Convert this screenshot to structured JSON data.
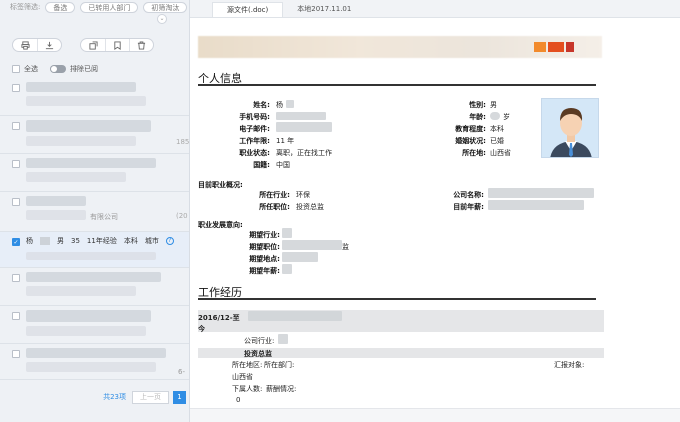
{
  "filter": {
    "label": "标签筛选:",
    "chips": [
      "备选",
      "已转用人部门",
      "初筛淘汰"
    ]
  },
  "toolbar": {
    "icons": [
      "print-icon",
      "download-icon",
      "forward-icon",
      "bookmark-icon",
      "trash-icon"
    ]
  },
  "list": {
    "select_all": "全选",
    "exclude_viewed": "排除已阅",
    "side_numbers": [
      "185",
      "(20"
    ],
    "company_fragment": "有限公司",
    "selected": {
      "name": "杨",
      "gender": "男",
      "age": "35",
      "experience": "11年经验",
      "education": "本科",
      "city": "城市"
    },
    "trailing_text": "6-"
  },
  "pagination": {
    "total": "共23项",
    "prev": "上一页",
    "page": "1"
  },
  "tabs": [
    "源文件(.doc)",
    "本地2017.11.01"
  ],
  "resume": {
    "section_personal": "个人信息",
    "name_label": "姓名:",
    "name_value": "杨",
    "gender_label": "性别:",
    "gender_value": "男",
    "phone_label": "手机号码:",
    "age_label": "年龄:",
    "age_value": "岁",
    "email_label": "电子邮件:",
    "edu_label": "教育程度:",
    "edu_value": "本科",
    "years_label": "工作年限:",
    "years_value": "11 年",
    "marital_label": "婚姻状况:",
    "marital_value": "已婚",
    "status_label": "职业状态:",
    "status_value": "离职，正在找工作",
    "location_label": "所在地:",
    "location_value": "山西省",
    "nationality_label": "国籍:",
    "nationality_value": "中国",
    "current_title": "目前职业概况:",
    "industry_label": "所在行业:",
    "industry_value": "环保",
    "company_label": "公司名称:",
    "position_label": "所任职位:",
    "position_value": "投资总监",
    "salary_label": "目前年薪:",
    "intent_title": "职业发展意向:",
    "exp_industry_label": "期望行业:",
    "exp_position_label": "期望职位:",
    "exp_position_frag": "监",
    "exp_location_label": "期望地点:",
    "exp_salary_label": "期望年薪:",
    "section_work": "工作经历",
    "work_date": "2016/12-至",
    "work_now": "今",
    "work_industry_label": "公司行业:",
    "work_position_value": "投资总监",
    "work_region_label": "所在地区:",
    "work_dept_label": "所在部门:",
    "work_report_label": "汇报对象:",
    "work_region_value": "山西省",
    "work_subordinates_label": "下属人数:",
    "work_reward_label": "薪酬情况:",
    "work_subordinates_value": "0"
  }
}
